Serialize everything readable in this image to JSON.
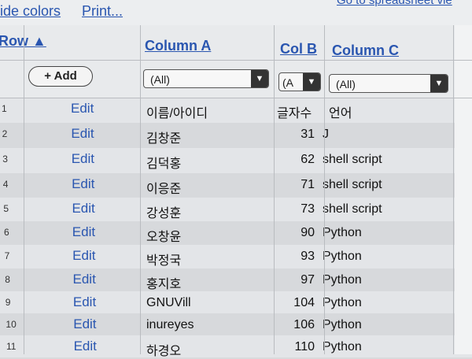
{
  "toolbar": {
    "hide_colors": "ide colors",
    "print": "Print...",
    "goto": "Go to spreadsheet vie"
  },
  "header": {
    "row_label": "Row ▲",
    "col_a": "Column A",
    "col_b": "Col B",
    "col_c": "Column C",
    "add_button": "+ Add",
    "filter_a": "(All)",
    "filter_b": "(A",
    "filter_c": "(All)"
  },
  "rows": [
    {
      "n": "1",
      "edit": "Edit",
      "a": "이름/아이디",
      "b": "글자수",
      "c": "언어"
    },
    {
      "n": "2",
      "edit": "Edit",
      "a": "김창준",
      "b": "31",
      "c": "J"
    },
    {
      "n": "3",
      "edit": "Edit",
      "a": "김덕홍",
      "b": "62",
      "c": "shell script"
    },
    {
      "n": "4",
      "edit": "Edit",
      "a": "이응준",
      "b": "71",
      "c": "shell script"
    },
    {
      "n": "5",
      "edit": "Edit",
      "a": "강성훈",
      "b": "73",
      "c": "shell script"
    },
    {
      "n": "6",
      "edit": "Edit",
      "a": "오창윤",
      "b": "90",
      "c": "Python"
    },
    {
      "n": "7",
      "edit": "Edit",
      "a": "박정국",
      "b": "93",
      "c": "Python"
    },
    {
      "n": "8",
      "edit": "Edit",
      "a": "홍지호",
      "b": "97",
      "c": "Python"
    },
    {
      "n": "9",
      "edit": "Edit",
      "a": "GNUVill",
      "b": "104",
      "c": "Python"
    },
    {
      "n": "10",
      "edit": "Edit",
      "a": "inureyes",
      "b": "106",
      "c": "Python"
    },
    {
      "n": "11",
      "edit": "Edit",
      "a": "하경오",
      "b": "110",
      "c": "Python"
    }
  ]
}
